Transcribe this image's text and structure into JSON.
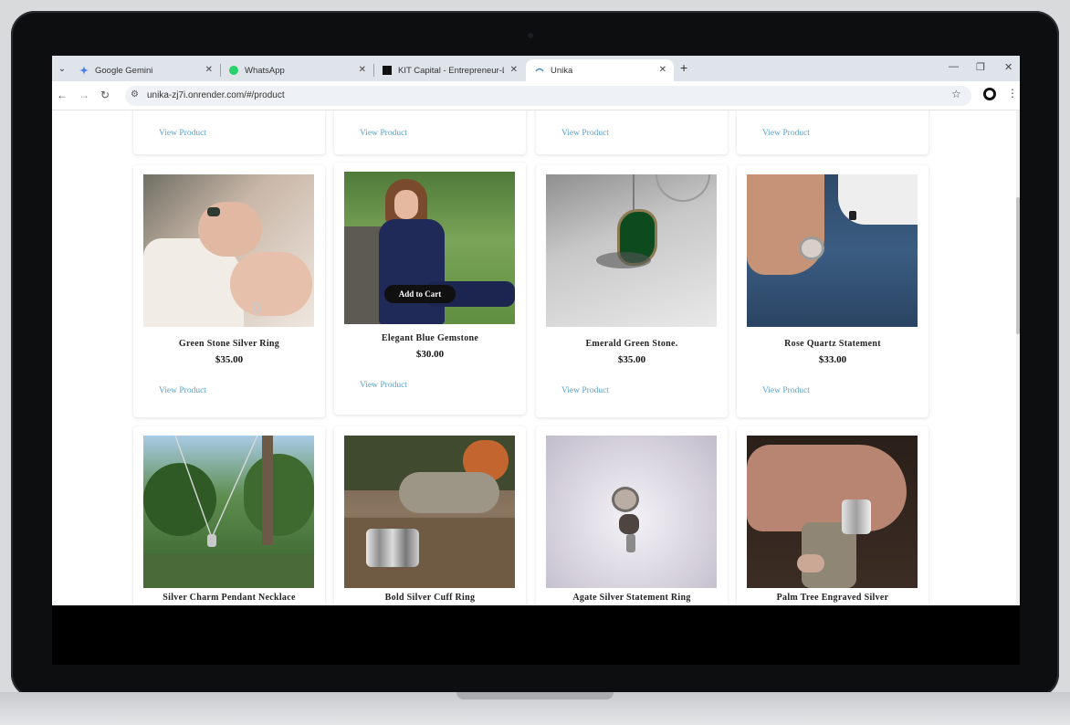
{
  "browser": {
    "tabs": [
      {
        "title": "Google Gemini",
        "active": false
      },
      {
        "title": "WhatsApp",
        "active": false
      },
      {
        "title": "KIT Capital - Entrepreneur-Led",
        "active": false
      },
      {
        "title": "Unika",
        "active": true
      }
    ],
    "url": "unika-zj7i.onrender.com/#/product"
  },
  "page": {
    "view_label": "View Product",
    "add_to_cart": "Add to Cart",
    "products_row1": [
      {
        "name": "Green Stone Silver Ring",
        "price": "$35.00"
      },
      {
        "name": "Elegant Blue Gemstone",
        "price": "$30.00"
      },
      {
        "name": "Emerald Green Stone.",
        "price": "$35.00"
      },
      {
        "name": "Rose Quartz Statement",
        "price": "$33.00"
      }
    ],
    "products_row2": [
      {
        "name": "Silver Charm Pendant Necklace"
      },
      {
        "name": "Bold Silver Cuff Ring"
      },
      {
        "name": "Agate Silver Statement Ring"
      },
      {
        "name": "Palm Tree Engraved Silver"
      }
    ]
  },
  "colors": {
    "link": "#5aa1c9",
    "tabbar": "#dfe3ea"
  }
}
